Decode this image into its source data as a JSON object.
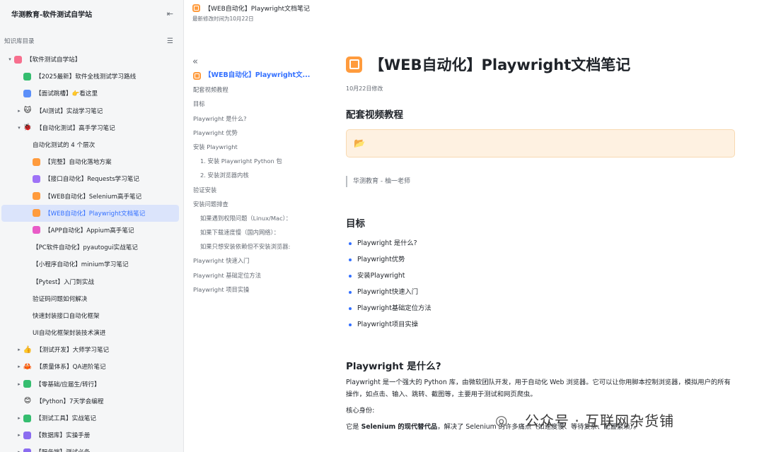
{
  "sidebar": {
    "title": "华测教育-软件测试自学站",
    "subheader": "知识库目录",
    "items": [
      {
        "label": "【软件测试自学站】",
        "caret": "▾",
        "icon": "pink-square-icon",
        "color": "#f76f8e",
        "level": 0
      },
      {
        "label": "【2025最新】软件全栈测试学习路线",
        "caret": "",
        "icon": "green-square-icon",
        "color": "#35bd6f",
        "level": 1
      },
      {
        "label": "【面试跳槽】👉看这里",
        "caret": "",
        "icon": "blue-square-icon",
        "color": "#5b8ff9",
        "level": 1
      },
      {
        "label": "【AI测试】实战学习笔记",
        "caret": "▸",
        "icon": "cat-icon",
        "emoji": "🐱",
        "level": 1
      },
      {
        "label": "【自动化测试】高手学习笔记",
        "caret": "▾",
        "icon": "bug-icon",
        "emoji": "🐞",
        "level": 1
      },
      {
        "label": "自动化测试的 4 个层次",
        "caret": "",
        "icon": "doc-icon",
        "level": 2
      },
      {
        "label": "【完整】自动化落地方案",
        "caret": "",
        "icon": "orange-square-icon",
        "color": "#ff9b3d",
        "level": 2
      },
      {
        "label": "【接口自动化】Requests学习笔记",
        "caret": "",
        "icon": "purple-square-icon",
        "color": "#9e72f7",
        "level": 2
      },
      {
        "label": "【WEB自动化】Selenium高手笔记",
        "caret": "",
        "icon": "orange-square-icon",
        "color": "#ff9b3d",
        "level": 2
      },
      {
        "label": "【WEB自动化】Playwright文档笔记",
        "caret": "",
        "icon": "orange-square-icon",
        "color": "#ff9b3d",
        "level": 2,
        "active": true
      },
      {
        "label": "【APP自动化】Appium高手笔记",
        "caret": "",
        "icon": "magenta-square-icon",
        "color": "#e95bc7",
        "level": 2
      },
      {
        "label": "【PC软件自动化】pyautogui实战笔记",
        "caret": "",
        "icon": "doc-icon",
        "level": 2
      },
      {
        "label": "【小程序自动化】minium学习笔记",
        "caret": "",
        "icon": "doc-icon",
        "level": 2
      },
      {
        "label": "【Pytest】入门到实战",
        "caret": "",
        "icon": "doc-icon",
        "level": 2
      },
      {
        "label": "验证码问题如何解决",
        "caret": "",
        "icon": "doc-icon",
        "level": 2
      },
      {
        "label": "快速封装接口自动化框架",
        "caret": "",
        "icon": "doc-icon",
        "level": 2
      },
      {
        "label": "UI自动化框架封装技术演进",
        "caret": "",
        "icon": "doc-icon",
        "level": 2
      },
      {
        "label": "【测试开发】大师学习笔记",
        "caret": "▸",
        "icon": "thumbs-up-icon",
        "emoji": "👍",
        "level": 1
      },
      {
        "label": "【质量体系】QA进阶笔记",
        "caret": "▸",
        "icon": "crab-icon",
        "emoji": "🦀",
        "level": 1
      },
      {
        "label": "【零基础/应届生/转行】",
        "caret": "▸",
        "icon": "green-square-icon",
        "color": "#35bd6f",
        "level": 1
      },
      {
        "label": "【Python】7天学会编程",
        "caret": "",
        "icon": "smile-icon",
        "emoji": "😊",
        "level": 1
      },
      {
        "label": "【测试工具】实战笔记",
        "caret": "▸",
        "icon": "green-square-icon",
        "color": "#35bd6f",
        "level": 1
      },
      {
        "label": "【数据库】实操手册",
        "caret": "▸",
        "icon": "violet-square-icon",
        "color": "#8b6cf0",
        "level": 1
      },
      {
        "label": "【服务端】测试必备",
        "caret": "▸",
        "icon": "violet-square-icon",
        "color": "#8b6cf0",
        "level": 1
      }
    ]
  },
  "header": {
    "title": "【WEB自动化】Playwright文档笔记",
    "modified": "最新修改时间为10月22日"
  },
  "outline": {
    "back": "«",
    "items": [
      {
        "label": "【WEB自动化】Playwright文...",
        "level": 0,
        "current": true
      },
      {
        "label": "配套视频教程",
        "level": 1
      },
      {
        "label": "目标",
        "level": 1
      },
      {
        "label": "Playwright 是什么?",
        "level": 1
      },
      {
        "label": "Playwright 优势",
        "level": 1
      },
      {
        "label": "安装 Playwright",
        "level": 1
      },
      {
        "label": "1. 安装 Playwright Python 包",
        "level": 2
      },
      {
        "label": "2. 安装浏览器内核",
        "level": 2
      },
      {
        "label": "验证安装",
        "level": 1
      },
      {
        "label": "安装问题排查",
        "level": 1
      },
      {
        "label": "如果遇到权限问题（Linux/Mac）：",
        "level": 2
      },
      {
        "label": "如果下载速度慢（国内网络）：",
        "level": 2
      },
      {
        "label": "如果只想安装依赖但不安装浏览器:",
        "level": 2
      },
      {
        "label": "Playwright 快速入门",
        "level": 1
      },
      {
        "label": "Playwright 基础定位方法",
        "level": 1
      },
      {
        "label": "Playwright 项目实操",
        "level": 1
      }
    ]
  },
  "doc": {
    "title": "【WEB自动化】Playwright文档笔记",
    "date": "10月22日修改",
    "section_video": "配套视频教程",
    "callout_icon": "📂",
    "quote": "华测教育 - 柚一老师",
    "section_goal": "目标",
    "goals": [
      "Playwright 是什么?",
      "Playwright优势",
      "安装Playwright",
      "Playwright快速入门",
      "Playwright基础定位方法",
      "Playwright项目实操"
    ],
    "section_what": "Playwright 是什么?",
    "para1": "Playwright 是一个强大的 Python 库，由微软团队开发，用于自动化 Web 浏览器。它可以让你用脚本控制浏览器，模拟用户的所有操作，如点击、输入、跳转、截图等，主要用于测试和网页爬虫。",
    "core_label": "核心身份:",
    "para2_a": "它是 ",
    "para2_b": "Selenium 的现代替代品",
    "para2_c": "，解决了 Selenium 的许多痛点（如速度慢、等待复杂、配置繁琐）。"
  },
  "watermark": {
    "text": "公众号 · 互联网杂货铺"
  }
}
